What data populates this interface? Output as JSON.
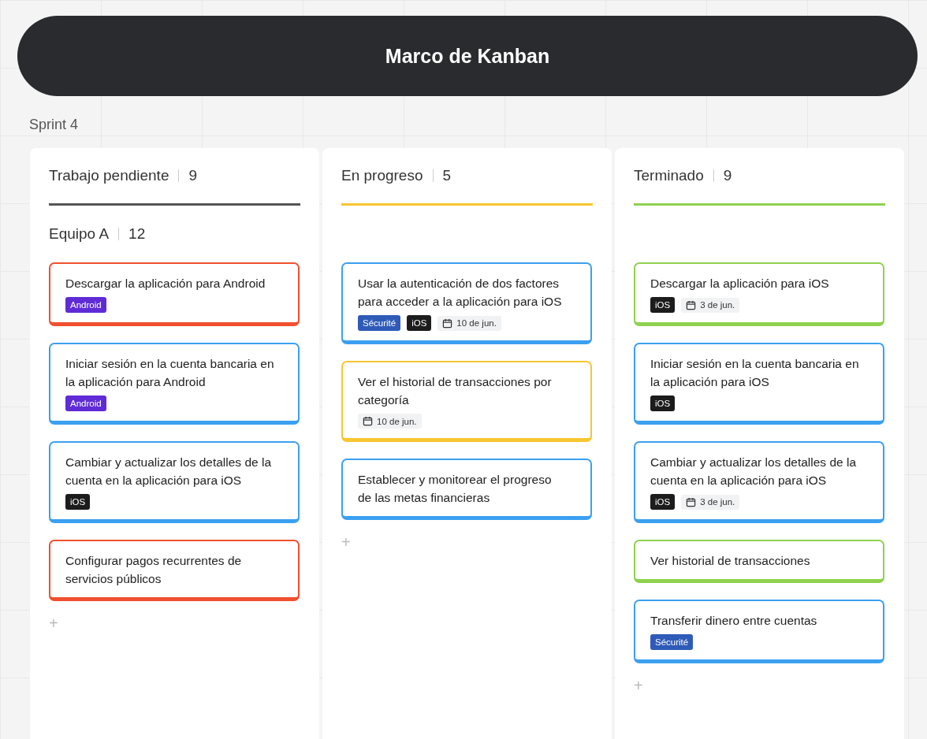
{
  "header": {
    "title": "Marco de Kanban"
  },
  "sprint": "Sprint 4",
  "columns": [
    {
      "title": "Trabajo pendiente",
      "count": "9",
      "color": "#555555",
      "lane": {
        "title": "Equipo A",
        "count": "12"
      },
      "add": "+",
      "cards": [
        {
          "title": "Descargar la aplicación para Android",
          "color": "#f0502f",
          "chips": [
            {
              "kind": "tag",
              "text": "Android",
              "color": "#5f2bd6"
            }
          ]
        },
        {
          "title": "Iniciar sesión en la cuenta bancaria en la aplicación para Android",
          "color": "#3ba0f0",
          "chips": [
            {
              "kind": "tag",
              "text": "Android",
              "color": "#5f2bd6"
            }
          ]
        },
        {
          "title": "Cambiar y actualizar los detalles de la cuenta en la aplicación para iOS",
          "color": "#3ba0f0",
          "chips": [
            {
              "kind": "tag",
              "text": "iOS",
              "color": "#1c1c1c"
            }
          ]
        },
        {
          "title": "Configurar pagos recurrentes de servicios públicos",
          "color": "#f0502f"
        }
      ]
    },
    {
      "title": "En progreso",
      "count": "5",
      "color": "#f7c62f",
      "add": "+",
      "cards": [
        {
          "title": "Usar la autenticación de dos factores para acceder a la aplicación para iOS",
          "color": "#3ba0f0",
          "chips": [
            {
              "kind": "tag",
              "text": "Sécurité",
              "color": "#2f5bb8"
            },
            {
              "kind": "tag",
              "text": "iOS",
              "color": "#1c1c1c"
            },
            {
              "kind": "date",
              "text": "10 de jun."
            }
          ]
        },
        {
          "title": "Ver el historial de transacciones por categoría",
          "color": "#f7c62f",
          "chips": [
            {
              "kind": "date",
              "text": "10 de jun."
            }
          ]
        },
        {
          "title": "Establecer y monitorear el progreso de las metas financieras",
          "color": "#3ba0f0"
        }
      ]
    },
    {
      "title": "Terminado",
      "count": "9",
      "color": "#8fd14f",
      "add": "+",
      "cards": [
        {
          "title": "Descargar la aplicación para iOS",
          "color": "#8fd14f",
          "chips": [
            {
              "kind": "tag",
              "text": "iOS",
              "color": "#1c1c1c"
            },
            {
              "kind": "date",
              "text": "3 de jun."
            }
          ]
        },
        {
          "title": "Iniciar sesión en la cuenta bancaria en la aplicación para iOS",
          "color": "#3ba0f0",
          "chips": [
            {
              "kind": "tag",
              "text": "iOS",
              "color": "#1c1c1c"
            }
          ]
        },
        {
          "title": "Cambiar y actualizar los detalles de la cuenta en la aplicación para iOS",
          "color": "#3ba0f0",
          "chips": [
            {
              "kind": "tag",
              "text": "iOS",
              "color": "#1c1c1c"
            },
            {
              "kind": "date",
              "text": "3 de jun."
            }
          ]
        },
        {
          "title": "Ver historial de transacciones",
          "color": "#8fd14f"
        },
        {
          "title": "Transferir dinero entre cuentas",
          "color": "#3ba0f0",
          "chips": [
            {
              "kind": "tag",
              "text": "Sécurité",
              "color": "#2f5bb8"
            }
          ]
        }
      ]
    }
  ]
}
